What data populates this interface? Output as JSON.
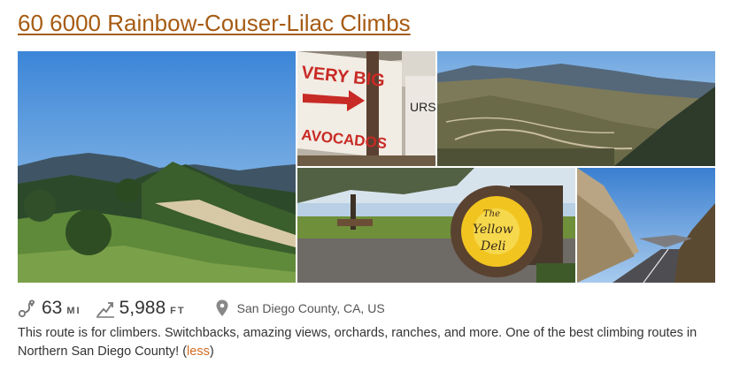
{
  "route": {
    "title": "60 6000 Rainbow-Couser-Lilac Climbs"
  },
  "photos": {
    "p1_alt": "Green hills with a dirt path under a blue sky",
    "p2_alt": "Wooden sign reading VERY BIG AVOCADOS",
    "p2_sign_line1": "VERY BIG",
    "p2_sign_line2": "AVOCADOS",
    "p2_sign_side": "URS",
    "p3_alt": "Mountain valley with switchback roads",
    "p4_alt": "The Yellow Deli sign beside a road",
    "p4_sign_line1": "The",
    "p4_sign_line2": "Yellow",
    "p4_sign_line3": "Deli",
    "p5_alt": "Road through a rocky canyon"
  },
  "stats": {
    "distance_value": "63",
    "distance_unit": "MI",
    "elevation_value": "5,988",
    "elevation_unit": "FT",
    "location": "San Diego County, CA, US",
    "icons": [
      "route-distance-icon",
      "elevation-icon",
      "location-pin-icon"
    ]
  },
  "description": {
    "text": "This route is for climbers. Switchbacks, amazing views, orchards, ranches, and more. One of the best climbing routes in Northern San Diego County! ",
    "open_paren": "(",
    "less_label": "less",
    "close_paren": ")"
  },
  "colors": {
    "title_link": "#a65b12",
    "less_link": "#d2691e",
    "icon_gray": "#777777"
  }
}
